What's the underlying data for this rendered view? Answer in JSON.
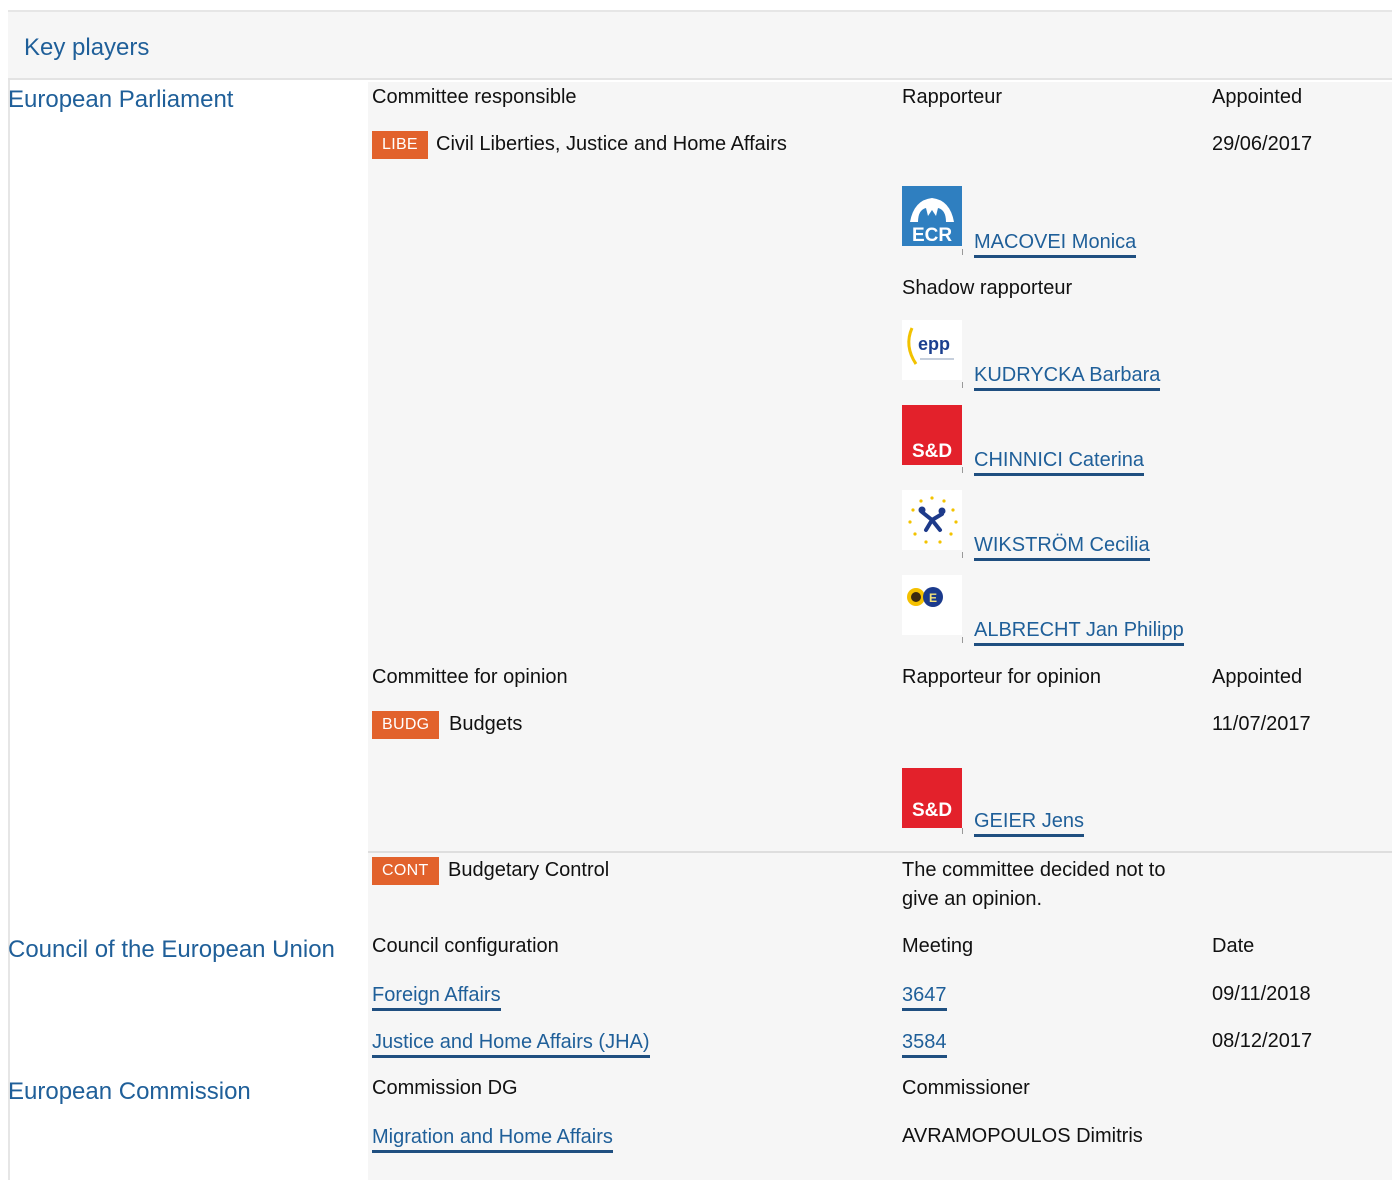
{
  "header": {
    "title": "Key players"
  },
  "ep": {
    "label": "European Parliament",
    "responsible_header": {
      "committee": "Committee responsible",
      "rapporteur": "Rapporteur",
      "appointed": "Appointed"
    },
    "responsible": {
      "badge": "LIBE",
      "name": "Civil Liberties, Justice and Home Affairs",
      "date": "29/06/2017",
      "rapporteur": {
        "logo": "ECR",
        "name": "MACOVEI Monica"
      },
      "shadow_label": "Shadow rapporteur",
      "shadows": [
        {
          "logo": "epp",
          "name": "KUDRYCKA Barbara"
        },
        {
          "logo": "S&D",
          "name": "CHINNICI Caterina"
        },
        {
          "logo": "alde-icon",
          "name": "WIKSTRÖM Cecilia"
        },
        {
          "logo": "greens-icon",
          "name": "ALBRECHT Jan Philipp"
        }
      ]
    },
    "opinion_header": {
      "committee": "Committee for opinion",
      "rapporteur": "Rapporteur for opinion",
      "appointed": "Appointed"
    },
    "opinion": [
      {
        "badge": "BUDG",
        "name": "Budgets",
        "date": "11/07/2017",
        "rapporteur": {
          "logo": "S&D",
          "name": "GEIER Jens"
        }
      },
      {
        "badge": "CONT",
        "name": "Budgetary Control",
        "note_line1": "The committee decided not to",
        "note_line2": "give an opinion."
      }
    ]
  },
  "council": {
    "label": "Council of the European Union",
    "header": {
      "configuration": "Council configuration",
      "meeting": "Meeting",
      "date": "Date"
    },
    "rows": [
      {
        "configuration": "Foreign Affairs",
        "meeting": "3647",
        "date": "09/11/2018"
      },
      {
        "configuration": "Justice and Home Affairs (JHA)",
        "meeting": "3584",
        "date": "08/12/2017"
      }
    ]
  },
  "commission": {
    "label": "European Commission",
    "header": {
      "dg": "Commission DG",
      "commissioner": "Commissioner"
    },
    "row": {
      "dg": "Migration and Home Affairs",
      "commissioner": "AVRAMOPOULOS Dimitris"
    }
  },
  "colors": {
    "link": "#1f5f99",
    "badge": "#e2622c",
    "panel": "#f6f6f6"
  }
}
